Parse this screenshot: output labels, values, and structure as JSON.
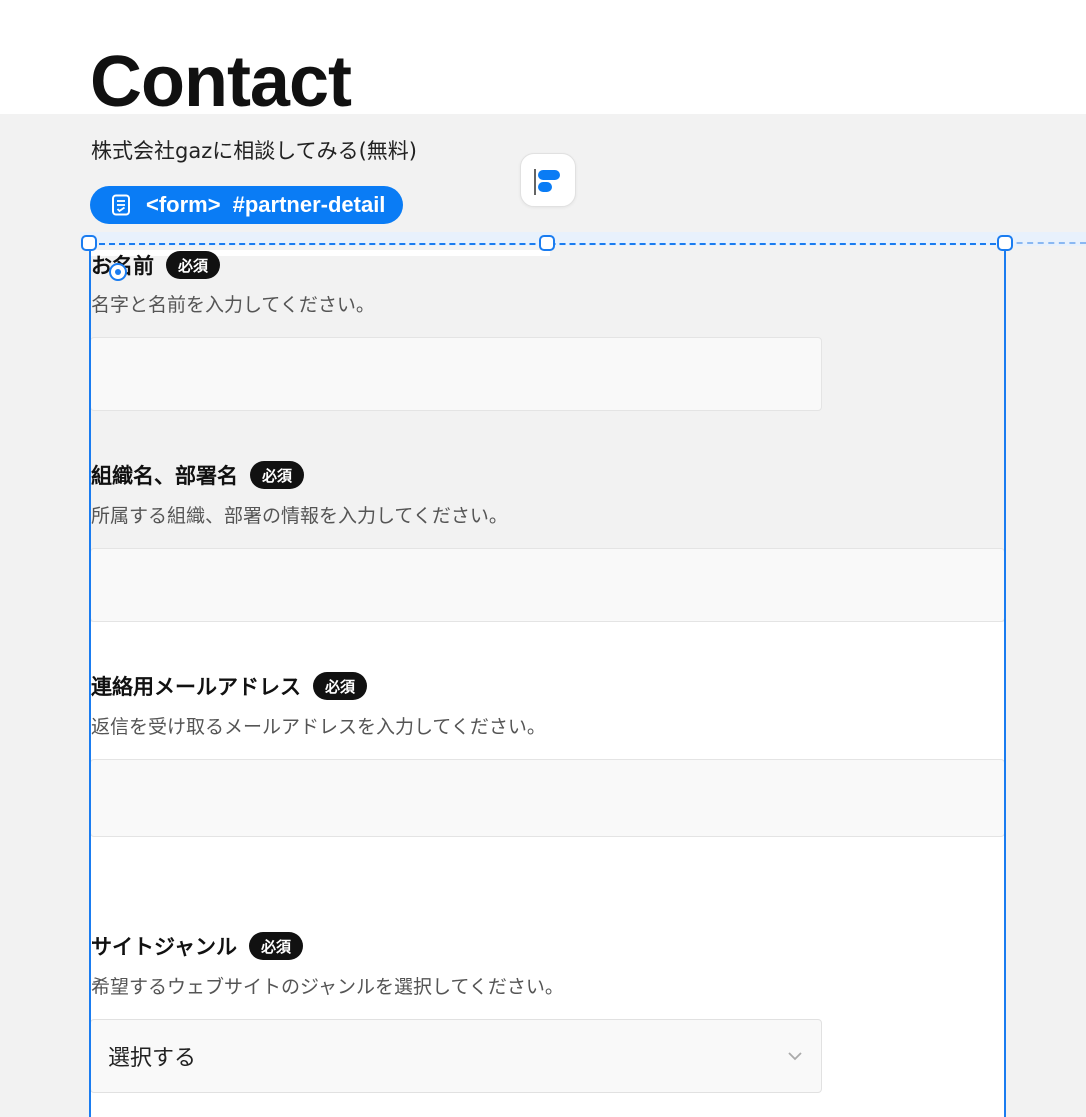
{
  "header": {
    "title": "Contact",
    "subtitle": "株式会社gazに相談してみる(無料)"
  },
  "form_tag": {
    "element": "<form>",
    "id": "#partner-detail"
  },
  "fields": [
    {
      "label": "お名前",
      "required_badge": "必須",
      "help": "名字と名前を入力してください。",
      "value": ""
    },
    {
      "label": "組織名、部署名",
      "required_badge": "必須",
      "help": "所属する組織、部署の情報を入力してください。",
      "value": ""
    },
    {
      "label": "連絡用メールアドレス",
      "required_badge": "必須",
      "help": "返信を受け取るメールアドレスを入力してください。",
      "value": ""
    },
    {
      "label": "サイトジャンル",
      "required_badge": "必須",
      "help": "希望するウェブサイトのジャンルを選択してください。",
      "selected": "選択する"
    }
  ],
  "icons": {
    "form_tag": "form-document-icon",
    "app": "framer-app-icon",
    "select": "chevron-down-icon"
  },
  "colors": {
    "accent": "#0a7cf5",
    "selection": "#1a7cf0",
    "badge_bg": "#111111",
    "page_bg": "#f2f2f2"
  }
}
